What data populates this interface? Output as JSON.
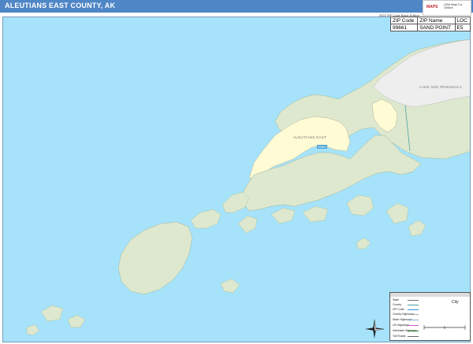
{
  "title": "ALEUTIANS EAST COUNTY, AK",
  "edition": "2022 ZIP Code Basic Edition",
  "logo": {
    "brand": "MAPS",
    "tagline": "USA Map Co. Online"
  },
  "zip_table": {
    "headers": [
      "ZIP Code",
      "ZIP Name",
      "LOC"
    ],
    "rows": [
      [
        "99661",
        "SAND POINT",
        "E5"
      ]
    ]
  },
  "map_labels": {
    "county_main": "ALEUTIANS EAST",
    "county_neighbor": "LAKE AND PENINSULA",
    "zip_marker": "99661"
  },
  "legend": {
    "items": [
      {
        "label": "State"
      },
      {
        "label": "County"
      },
      {
        "label": "ZIP Code"
      },
      {
        "label": "County Highways"
      },
      {
        "label": "State Highways"
      },
      {
        "label": "US Highways"
      },
      {
        "label": "Interstate Highways"
      },
      {
        "label": "Toll Roads"
      }
    ],
    "city_label": "City"
  },
  "colors": {
    "water": "#a6e3fb",
    "land": "#dde8cf",
    "county_highlight": "#fffbd5",
    "neighbor_land": "#eeeeee",
    "title_bar": "#4f86c6"
  }
}
